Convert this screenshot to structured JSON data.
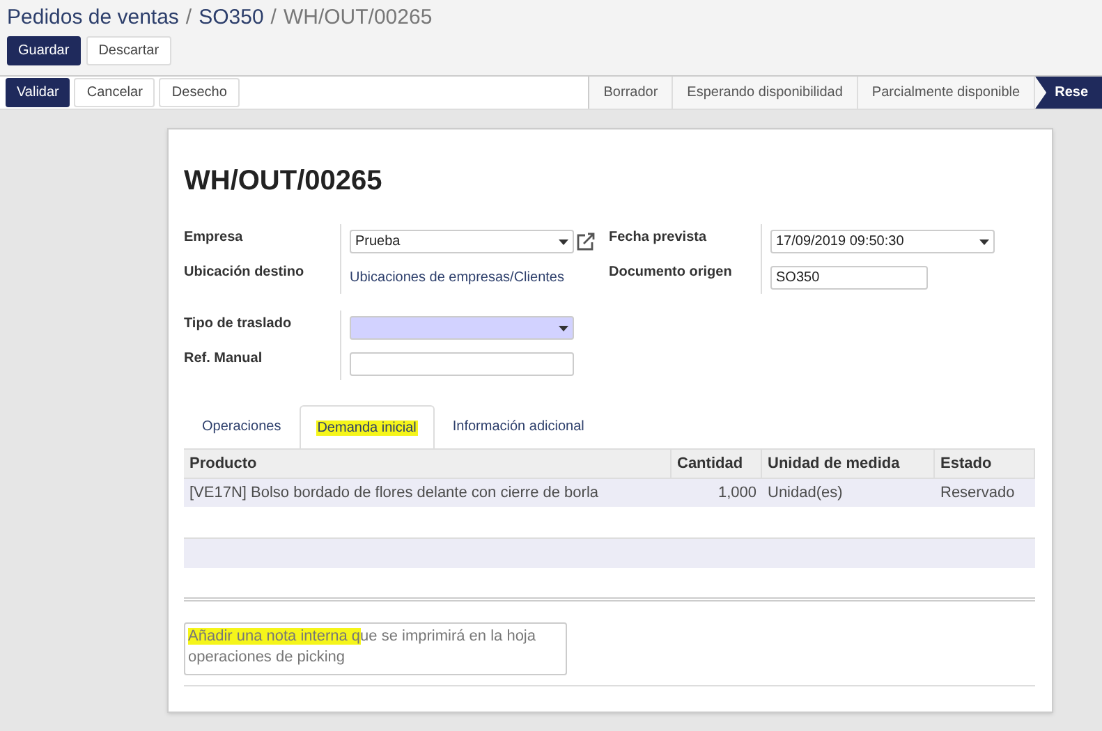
{
  "breadcrumb": [
    {
      "label": "Pedidos de ventas",
      "link": true,
      "separator": "/"
    },
    {
      "label": "SO350",
      "link": true,
      "separator": "/"
    },
    {
      "label": "WH/OUT/00265",
      "link": false
    }
  ],
  "edit_buttons": [
    {
      "label": "Guardar",
      "primary": true
    },
    {
      "label": "Descartar",
      "primary": false
    }
  ],
  "action_buttons": [
    {
      "label": "Validar",
      "primary": true
    },
    {
      "label": "Cancelar",
      "primary": false
    },
    {
      "label": "Desecho",
      "primary": false
    }
  ],
  "statuses": [
    {
      "label": "Borrador",
      "selected": false
    },
    {
      "label": "Esperando disponibilidad",
      "selected": false
    },
    {
      "label": "Parcialmente disponible",
      "selected": false
    },
    {
      "label": "Rese",
      "selected": true
    }
  ],
  "title": "WH/OUT/00265",
  "left_fields": [
    {
      "label": "Empresa",
      "kind": "select",
      "value": "Prueba",
      "external_link": true
    },
    {
      "label": "Ubicación destino",
      "kind": "link",
      "value": "Ubicaciones de empresas/Clientes"
    }
  ],
  "right_fields": [
    {
      "label": "Fecha prevista",
      "kind": "select",
      "value": "17/09/2019 09:50:30"
    },
    {
      "label": "Documento origen",
      "kind": "input",
      "value": "SO350"
    }
  ],
  "lower_fields": [
    {
      "label": "Tipo de traslado",
      "kind": "required_select"
    },
    {
      "label": "Ref. Manual",
      "kind": "input"
    }
  ],
  "tabs": [
    {
      "label": "Operaciones",
      "selected": false,
      "highlighted": false
    },
    {
      "label": "Demanda inicial",
      "selected": true,
      "highlighted": true
    },
    {
      "label": "Información adicional",
      "selected": false,
      "highlighted": false
    }
  ],
  "table": {
    "columns": [
      "Producto",
      "Cantidad",
      "Unidad de medida",
      "Estado"
    ],
    "rows": [
      [
        "[VE17N] Bolso bordado de flores delante con cierre de borla",
        "1,000",
        "Unidad(es)",
        "Reservado"
      ]
    ]
  },
  "note": {
    "highlighted_part": "Añadir una nota interna q",
    "rest": "ue se imprimirá en la hoja operaciones de picking"
  }
}
